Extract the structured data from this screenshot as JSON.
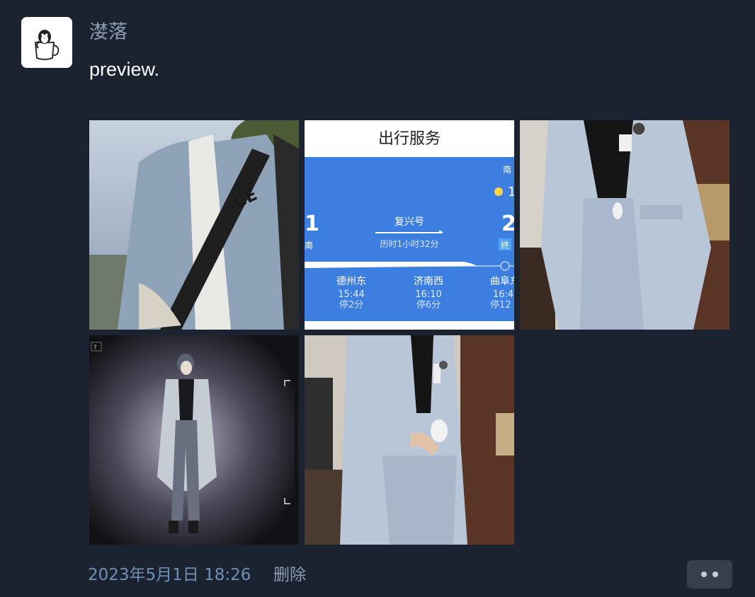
{
  "post": {
    "author": "漤落",
    "text": "preview.",
    "timestamp": "2023年5月1日 18:26",
    "delete_label": "删除"
  },
  "travel_card": {
    "title": "出行服务",
    "top_right": "南",
    "train_name": "复兴号",
    "duration": "历时1小时32分",
    "left_num": "1",
    "left_tag": "南",
    "right_num": "2",
    "right_tag": "终",
    "weather_num": "1",
    "stops": [
      {
        "name": "德州东",
        "time": "15:44",
        "stop": "停2分"
      },
      {
        "name": "济南西",
        "time": "16:10",
        "stop": "停6分"
      },
      {
        "name": "曲阜东",
        "time": "16:4",
        "stop": "停12"
      }
    ]
  },
  "anime_image": {
    "corner_badge": "?"
  },
  "colors": {
    "background": "#1b2331",
    "author": "#8e9cb3",
    "timestamp": "#6f8fb6",
    "card_blue": "#3d7fe0"
  }
}
